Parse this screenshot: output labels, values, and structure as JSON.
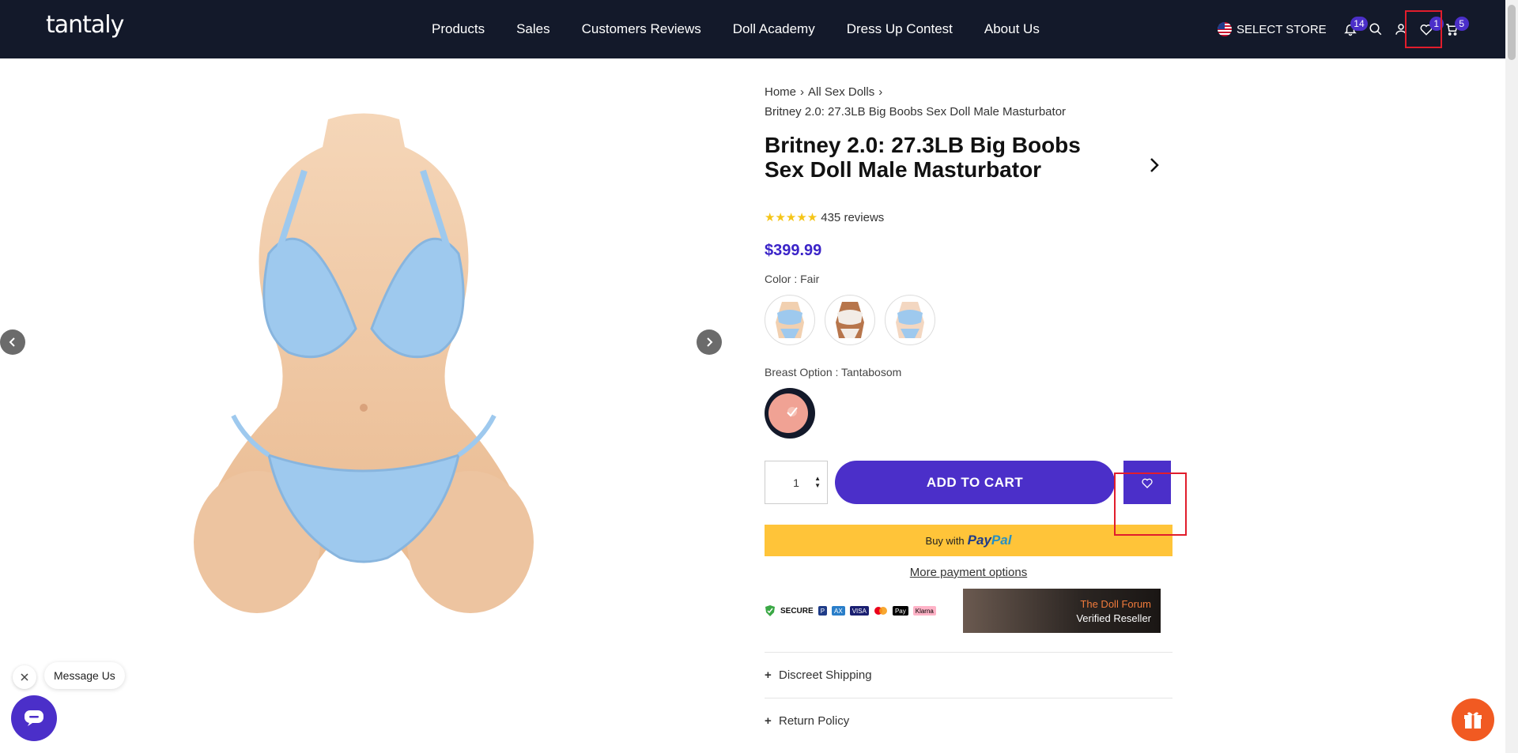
{
  "header": {
    "logo": "tantaly",
    "nav": [
      "Products",
      "Sales",
      "Customers Reviews",
      "Doll Academy",
      "Dress Up Contest",
      "About Us"
    ],
    "store_label": "SELECT STORE",
    "notifications_count": "14",
    "wishlist_count": "1",
    "cart_count": "5"
  },
  "breadcrumb": {
    "home": "Home",
    "category": "All Sex Dolls",
    "current": "Britney 2.0: 27.3LB Big Boobs Sex Doll Male Masturbator"
  },
  "product": {
    "title": "Britney 2.0: 27.3LB Big Boobs Sex Doll Male Masturbator",
    "rating_stars": "★★★★★",
    "reviews": "435 reviews",
    "price": "$399.99",
    "color_label": "Color : Fair",
    "breast_label": "Breast Option : Tantabosom",
    "quantity": "1",
    "add_to_cart": "ADD TO CART",
    "paypal_prefix": "Buy with",
    "paypal_brand_a": "Pay",
    "paypal_brand_b": "Pal",
    "more_payment": "More payment options",
    "secure_label": "SECURE",
    "cards": [
      "VISA",
      "Pay",
      "Klarna"
    ],
    "forum_line1": "The Doll Forum",
    "forum_line2": "Verified Reseller",
    "accordion": [
      "Discreet Shipping",
      "Return Policy"
    ]
  },
  "chat": {
    "message_us": "Message Us"
  },
  "colors": {
    "accent": "#4b2fc9",
    "header_bg": "#13192a",
    "paypal_yellow": "#ffc439",
    "highlight": "#e11d2c"
  }
}
